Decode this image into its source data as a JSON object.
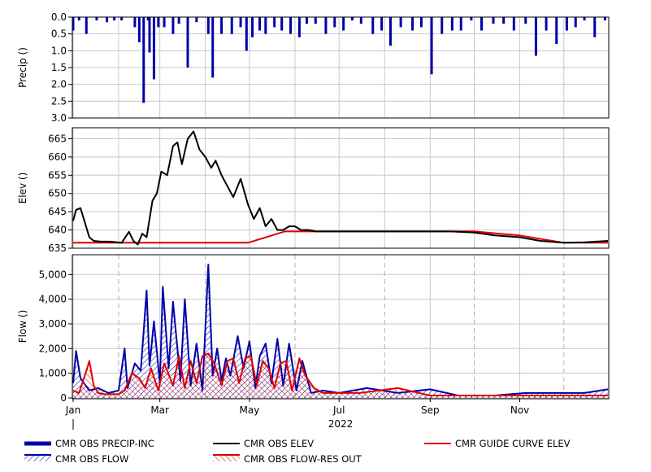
{
  "chart_data": [
    {
      "type": "bar",
      "ylabel": "Precip ()",
      "ylim": [
        3.0,
        0.0
      ],
      "y_inverted": true,
      "yticks": [
        "0.0",
        "0.5",
        "1.0",
        "1.5",
        "2.0",
        "2.5",
        "3.0"
      ],
      "grid": true,
      "color": "#0000aa",
      "series": [
        {
          "name": "CMR OBS PRECIP-INC",
          "x": [
            "2022-01-01",
            "2022-01-05",
            "2022-01-10",
            "2022-01-17",
            "2022-01-24",
            "2022-01-29",
            "2022-02-03",
            "2022-02-12",
            "2022-02-15",
            "2022-02-18",
            "2022-02-21",
            "2022-02-22",
            "2022-02-25",
            "2022-02-28",
            "2022-03-04",
            "2022-03-10",
            "2022-03-14",
            "2022-03-20",
            "2022-03-26",
            "2022-04-03",
            "2022-04-06",
            "2022-04-12",
            "2022-04-19",
            "2022-04-25",
            "2022-04-29",
            "2022-05-03",
            "2022-05-08",
            "2022-05-12",
            "2022-05-18",
            "2022-05-23",
            "2022-05-29",
            "2022-06-04",
            "2022-06-09",
            "2022-06-15",
            "2022-06-22",
            "2022-06-28",
            "2022-07-04",
            "2022-07-10",
            "2022-07-16",
            "2022-07-24",
            "2022-07-30",
            "2022-08-05",
            "2022-08-12",
            "2022-08-20",
            "2022-08-26",
            "2022-09-02",
            "2022-09-09",
            "2022-09-16",
            "2022-09-22",
            "2022-09-29",
            "2022-10-06",
            "2022-10-14",
            "2022-10-21",
            "2022-10-28",
            "2022-11-05",
            "2022-11-12",
            "2022-11-19",
            "2022-11-26",
            "2022-12-03",
            "2022-12-09",
            "2022-12-15",
            "2022-12-22",
            "2022-12-29"
          ],
          "values": [
            0.4,
            0.1,
            0.5,
            0.1,
            0.15,
            0.1,
            0.1,
            0.3,
            0.75,
            2.55,
            0.1,
            1.05,
            1.85,
            0.3,
            0.3,
            0.5,
            0.2,
            1.5,
            0.15,
            0.5,
            1.8,
            0.5,
            0.5,
            0.3,
            1.0,
            0.6,
            0.4,
            0.5,
            0.3,
            0.4,
            0.5,
            0.6,
            0.2,
            0.2,
            0.5,
            0.3,
            0.4,
            0.1,
            0.2,
            0.5,
            0.4,
            0.85,
            0.3,
            0.4,
            0.3,
            1.7,
            0.5,
            0.4,
            0.4,
            0.1,
            0.4,
            0.2,
            0.2,
            0.4,
            0.2,
            1.15,
            0.4,
            0.8,
            0.4,
            0.3,
            0.1,
            0.6,
            0.1
          ]
        }
      ]
    },
    {
      "type": "line",
      "ylabel": "Elev ()",
      "ylim": [
        635,
        668
      ],
      "yticks": [
        "635",
        "640",
        "645",
        "650",
        "655",
        "660",
        "665"
      ],
      "grid": true,
      "series": [
        {
          "name": "CMR OBS ELEV",
          "color": "#000000",
          "x": [
            "2022-01-01",
            "2022-01-03",
            "2022-01-06",
            "2022-01-09",
            "2022-01-12",
            "2022-01-15",
            "2022-01-20",
            "2022-01-26",
            "2022-02-03",
            "2022-02-08",
            "2022-02-11",
            "2022-02-14",
            "2022-02-17",
            "2022-02-20",
            "2022-02-24",
            "2022-02-27",
            "2022-03-02",
            "2022-03-06",
            "2022-03-10",
            "2022-03-13",
            "2022-03-16",
            "2022-03-20",
            "2022-03-24",
            "2022-03-28",
            "2022-04-01",
            "2022-04-05",
            "2022-04-08",
            "2022-04-12",
            "2022-04-16",
            "2022-04-20",
            "2022-04-25",
            "2022-04-30",
            "2022-05-04",
            "2022-05-08",
            "2022-05-12",
            "2022-05-16",
            "2022-05-20",
            "2022-05-24",
            "2022-05-28",
            "2022-06-01",
            "2022-06-05",
            "2022-06-10",
            "2022-06-15",
            "2022-06-22",
            "2022-07-01",
            "2022-07-15",
            "2022-08-01",
            "2022-08-15",
            "2022-09-01",
            "2022-09-15",
            "2022-10-01",
            "2022-10-15",
            "2022-11-01",
            "2022-11-15",
            "2022-12-01",
            "2022-12-15",
            "2022-12-31"
          ],
          "values": [
            642.5,
            645.5,
            646,
            642,
            638,
            637,
            636.8,
            636.8,
            636.5,
            639.5,
            637,
            636,
            639,
            638,
            648,
            650,
            656,
            655,
            663,
            664,
            658,
            665,
            667,
            662,
            660,
            657,
            659,
            655,
            652,
            649,
            654,
            647,
            643,
            646,
            641,
            643,
            640,
            640,
            641,
            641,
            640,
            640,
            639.6,
            639.6,
            639.6,
            639.6,
            639.6,
            639.6,
            639.6,
            639.6,
            639.3,
            638.5,
            638,
            637,
            636.5,
            636.6,
            637
          ]
        },
        {
          "name": "CMR GUIDE CURVE ELEV",
          "color": "#dd0000",
          "x": [
            "2022-01-01",
            "2022-04-30",
            "2022-05-25",
            "2022-06-10",
            "2022-10-01",
            "2022-11-01",
            "2022-12-01",
            "2022-12-31"
          ],
          "values": [
            636.5,
            636.5,
            639.6,
            639.6,
            639.6,
            638.5,
            636.5,
            636.5
          ]
        }
      ]
    },
    {
      "type": "area",
      "ylabel": "Flow ()",
      "ylim": [
        0,
        5800
      ],
      "yticks": [
        "0",
        "1,000",
        "2,000",
        "3,000",
        "4,000",
        "5,000"
      ],
      "xtick_labels": [
        "Jan",
        "Mar",
        "May",
        "Jul",
        "Sep",
        "Nov"
      ],
      "year_label": "2022",
      "grid": true,
      "series": [
        {
          "name": "CMR OBS FLOW",
          "color": "#0000aa",
          "pattern": "hatch",
          "x": [
            "2022-01-01",
            "2022-01-03",
            "2022-01-06",
            "2022-01-12",
            "2022-01-18",
            "2022-01-25",
            "2022-02-01",
            "2022-02-05",
            "2022-02-07",
            "2022-02-12",
            "2022-02-16",
            "2022-02-20",
            "2022-02-22",
            "2022-02-25",
            "2022-03-01",
            "2022-03-03",
            "2022-03-07",
            "2022-03-10",
            "2022-03-15",
            "2022-03-18",
            "2022-03-22",
            "2022-03-26",
            "2022-03-30",
            "2022-04-03",
            "2022-04-06",
            "2022-04-09",
            "2022-04-12",
            "2022-04-15",
            "2022-04-18",
            "2022-04-23",
            "2022-04-27",
            "2022-05-01",
            "2022-05-05",
            "2022-05-08",
            "2022-05-12",
            "2022-05-16",
            "2022-05-20",
            "2022-05-24",
            "2022-05-28",
            "2022-06-02",
            "2022-06-06",
            "2022-06-12",
            "2022-06-20",
            "2022-07-01",
            "2022-07-20",
            "2022-08-10",
            "2022-09-01",
            "2022-09-20",
            "2022-10-15",
            "2022-11-05",
            "2022-11-25",
            "2022-12-15",
            "2022-12-31"
          ],
          "values": [
            600,
            1900,
            800,
            300,
            400,
            200,
            300,
            2000,
            400,
            1400,
            1100,
            4350,
            1300,
            3100,
            600,
            4500,
            1200,
            3900,
            700,
            4000,
            500,
            2200,
            300,
            5400,
            900,
            2000,
            700,
            1600,
            900,
            2500,
            1200,
            2300,
            400,
            1700,
            2200,
            600,
            2400,
            500,
            2200,
            300,
            1500,
            200,
            300,
            200,
            400,
            200,
            350,
            100,
            100,
            200,
            200,
            200,
            350
          ]
        },
        {
          "name": "CMR OBS FLOW-RES OUT",
          "color": "#dd0000",
          "pattern": "hatch",
          "x": [
            "2022-01-01",
            "2022-01-05",
            "2022-01-10",
            "2022-01-12",
            "2022-01-15",
            "2022-01-18",
            "2022-01-22",
            "2022-02-01",
            "2022-02-05",
            "2022-02-10",
            "2022-02-15",
            "2022-02-19",
            "2022-02-23",
            "2022-02-28",
            "2022-03-04",
            "2022-03-10",
            "2022-03-14",
            "2022-03-18",
            "2022-03-22",
            "2022-03-26",
            "2022-03-30",
            "2022-04-03",
            "2022-04-07",
            "2022-04-12",
            "2022-04-16",
            "2022-04-20",
            "2022-04-24",
            "2022-04-28",
            "2022-05-02",
            "2022-05-06",
            "2022-05-10",
            "2022-05-14",
            "2022-05-18",
            "2022-05-22",
            "2022-05-26",
            "2022-05-30",
            "2022-06-04",
            "2022-06-08",
            "2022-06-14",
            "2022-06-20",
            "2022-07-15",
            "2022-08-10",
            "2022-09-01",
            "2022-10-01",
            "2022-11-01",
            "2022-12-01",
            "2022-12-31"
          ],
          "values": [
            300,
            200,
            1100,
            1500,
            500,
            200,
            150,
            150,
            300,
            1000,
            800,
            400,
            1200,
            300,
            1400,
            500,
            1700,
            400,
            1500,
            600,
            1700,
            1800,
            1400,
            500,
            1500,
            1600,
            600,
            1600,
            1700,
            500,
            1500,
            1200,
            400,
            1400,
            1500,
            300,
            1600,
            900,
            400,
            200,
            200,
            400,
            100,
            100,
            100,
            100,
            100
          ]
        }
      ]
    }
  ],
  "legend": [
    {
      "label": "CMR OBS PRECIP-INC",
      "style": "thick-line",
      "color": "#0000aa"
    },
    {
      "label": "CMR OBS ELEV",
      "style": "line",
      "color": "#000000"
    },
    {
      "label": "CMR GUIDE CURVE ELEV",
      "style": "line",
      "color": "#dd0000"
    },
    {
      "label": "CMR OBS FLOW",
      "style": "hatch",
      "color": "#0000aa"
    },
    {
      "label": "CMR OBS FLOW-RES OUT",
      "style": "hatch",
      "color": "#dd0000"
    }
  ]
}
